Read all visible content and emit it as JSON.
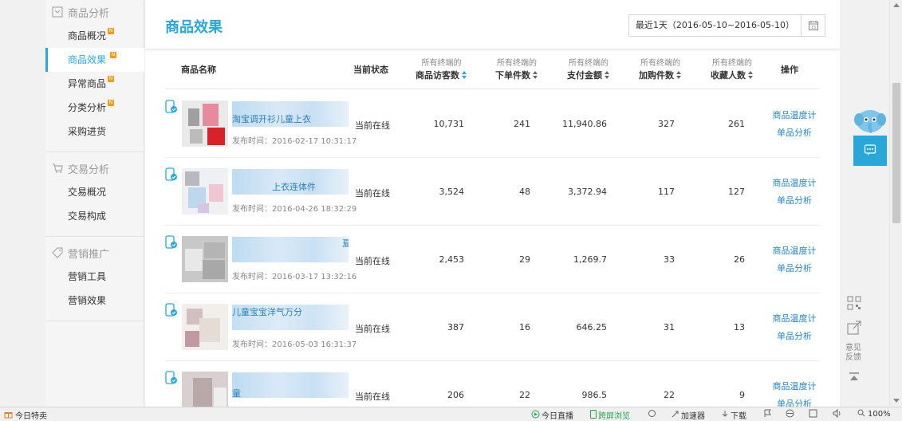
{
  "sidebar": {
    "sections": [
      {
        "title": "商品分析",
        "items": [
          {
            "label": "商品概况",
            "badge": "N"
          },
          {
            "label": "商品效果",
            "badge": "N",
            "active": true
          },
          {
            "label": "异常商品",
            "badge": "N"
          },
          {
            "label": "分类分析",
            "badge": "N"
          },
          {
            "label": "采购进货"
          }
        ]
      },
      {
        "title": "交易分析",
        "items": [
          {
            "label": "交易概况"
          },
          {
            "label": "交易构成"
          }
        ]
      },
      {
        "title": "营销推广",
        "items": [
          {
            "label": "营销工具"
          },
          {
            "label": "营销效果"
          }
        ]
      }
    ]
  },
  "main": {
    "title": "商品效果",
    "date_range": "最近1天（2016-05-10~2016-05-10）",
    "table": {
      "headers": {
        "name": "商品名称",
        "status": "当前状态",
        "visitors_sub": "所有终端的",
        "visitors": "商品访客数",
        "orders_sub": "所有终端的",
        "orders": "下单件数",
        "pay_sub": "所有终端的",
        "pay": "支付金额",
        "cart_sub": "所有终端的",
        "cart": "加购件数",
        "fav_sub": "所有终端的",
        "fav": "收藏人数",
        "ops": "操作"
      },
      "rows": [
        {
          "name": "淘宝调开衫儿童上衣",
          "publish": "发布时间：2016-02-17 10:31:17",
          "status": "当前在线",
          "visitors": "10,731",
          "orders": "241",
          "pay": "11,940.86",
          "cart": "327",
          "fav": "261",
          "op1": "商品温度计",
          "op2": "单品分析"
        },
        {
          "name": "上衣连体件",
          "publish": "发布时间：2016-04-26 18:32:29",
          "status": "当前在线",
          "visitors": "3,524",
          "orders": "48",
          "pay": "3,372.94",
          "cart": "117",
          "fav": "127",
          "op1": "商品温度计",
          "op2": "单品分析"
        },
        {
          "name": "夏",
          "publish": "发布时间：2016-03-17 13:32:16",
          "status": "当前在线",
          "visitors": "2,453",
          "orders": "29",
          "pay": "1,269.7",
          "cart": "33",
          "fav": "26",
          "op1": "商品温度计",
          "op2": "单品分析"
        },
        {
          "name": "儿童宝宝洋气万分",
          "publish": "发布时间：2016-05-03 16:31:37",
          "status": "当前在线",
          "visitors": "387",
          "orders": "16",
          "pay": "646.25",
          "cart": "31",
          "fav": "13",
          "op1": "商品温度计",
          "op2": "单品分析"
        },
        {
          "name": "童",
          "publish": "",
          "status": "当前在线",
          "visitors": "206",
          "orders": "22",
          "pay": "986.5",
          "cart": "22",
          "fav": "9",
          "op1": "商品温度计",
          "op2": "单品分析"
        }
      ]
    }
  },
  "side_tools": {
    "feedback": "意见反馈"
  },
  "statusbar": {
    "left": "今日特卖",
    "live": "今日直播",
    "cross_screen": "跨屏浏览",
    "accelerator": "加速器",
    "download": "下载",
    "zoom": "100%"
  },
  "colors": {
    "accent": "#2aa7d9",
    "link": "#2a86c7",
    "badge": "#f39c12"
  }
}
